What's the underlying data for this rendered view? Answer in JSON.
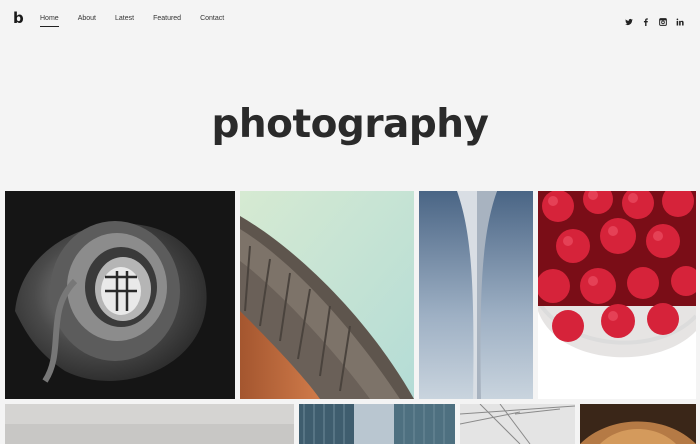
{
  "brand": {
    "logo": "b"
  },
  "nav": {
    "items": [
      {
        "label": "Home",
        "active": true
      },
      {
        "label": "About",
        "active": false
      },
      {
        "label": "Latest",
        "active": false
      },
      {
        "label": "Featured",
        "active": false
      },
      {
        "label": "Contact",
        "active": false
      }
    ]
  },
  "social": [
    "twitter-icon",
    "facebook-icon",
    "instagram-icon",
    "linkedin-icon"
  ],
  "hero": {
    "title": "photography"
  },
  "gallery": {
    "tiles": [
      "spiral-staircase-photo",
      "curved-roof-photo",
      "tall-spire-photo",
      "raspberries-bowl-photo",
      "foggy-sky-photo",
      "glass-towers-photo",
      "wire-structure-photo",
      "wooden-arch-photo"
    ]
  },
  "colors": {
    "background": "#f4f4f4",
    "text": "#222222"
  }
}
